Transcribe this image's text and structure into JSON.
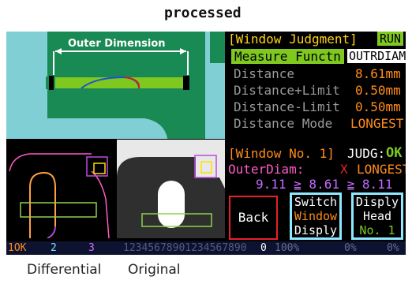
{
  "caption_top": "processed",
  "caption_left": "Differential",
  "caption_right": "Original",
  "outer_dimension_label": "Outer Dimension",
  "panel": {
    "title": "[Window Judgment]",
    "run_badge": "RUN",
    "measure_label": "Measure Functn",
    "measure_value": "OUTRDIAM",
    "rows": [
      {
        "label": "Distance",
        "value": "8.61mm"
      },
      {
        "label": "Distance+Limit",
        "value": "0.50mm"
      },
      {
        "label": "Distance-Limit",
        "value": "0.50mm"
      },
      {
        "label": "Distance Mode",
        "value": "LONGEST"
      }
    ]
  },
  "window": {
    "header": "[Window No. 1]",
    "judg_label": "JUDG:",
    "judg_value": "OK",
    "outer_label": "OuterDiam:",
    "x_mark": "X",
    "mode": "LONGEST",
    "equation": "9.11 ≧ 8.61 ≧ 8.11"
  },
  "buttons": {
    "back": "Back",
    "switch": [
      "Switch",
      "Window",
      "Disply"
    ],
    "head": [
      "Disply",
      "Head",
      "No. 1"
    ]
  },
  "status": {
    "ok": "1OK",
    "two": "2",
    "three": "3",
    "digits": "12345678901234567890",
    "zero": "0",
    "pct1": "100%",
    "pct2": "0%",
    "pct3": "0%"
  },
  "colors": {
    "accent_green": "#7ec820",
    "value_orange": "#ff8c1a",
    "label_grey": "#9a9a9a",
    "title_yellow": "#ffd21a",
    "teal_bg": "#7fcfd5",
    "dark_green_part": "#1a8a55"
  }
}
